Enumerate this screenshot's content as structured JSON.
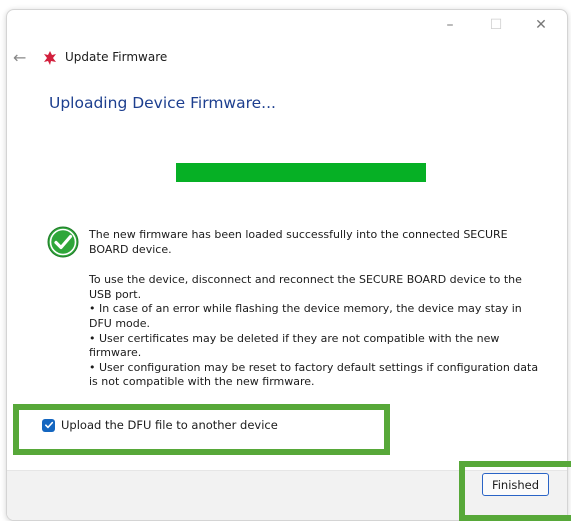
{
  "window": {
    "title": "Update Firmware",
    "controls": {
      "minimize": "–",
      "maximize": "☐",
      "close": "✕"
    },
    "back_icon": "back-arrow-icon",
    "app_icon": "red-spark-icon"
  },
  "main": {
    "heading": "Uploading Device Firmware...",
    "progress": {
      "value": 1.0,
      "color": "#06b025"
    },
    "status_icon": "success-check-icon",
    "message": {
      "p1": "The new firmware has been loaded successfully into the connected SECURE BOARD device.",
      "p2_lines": [
        "To use the device, disconnect and reconnect the SECURE BOARD device to the USB port.",
        "• In case of an error while flashing the device memory, the device may stay in DFU mode.",
        "• User certificates may be deleted if they are not compatible with the new firmware.",
        "• User configuration may be reset to factory default settings if configuration data is not compatible with the new firmware."
      ]
    },
    "checkbox": {
      "label": "Upload the DFU file to another device",
      "checked": true
    }
  },
  "footer": {
    "finish_label": "Finished"
  },
  "colors": {
    "accent": "#1466c0",
    "heading": "#1d3f8f",
    "highlight": "#57a839",
    "success": "#06b025"
  }
}
